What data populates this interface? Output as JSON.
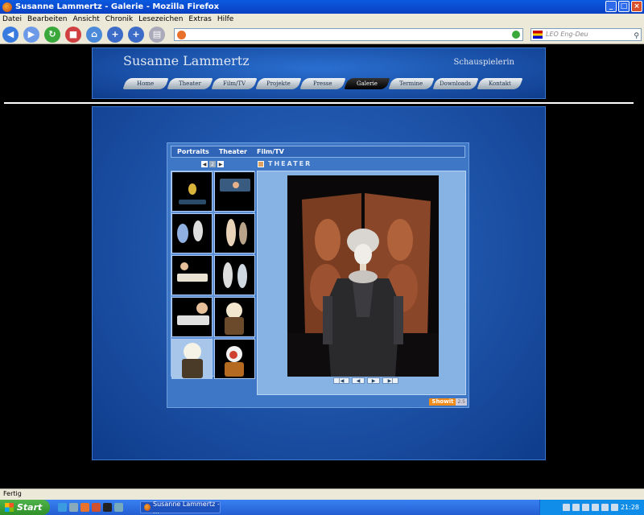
{
  "window": {
    "title": "Susanne Lammertz - Galerie - Mozilla Firefox"
  },
  "menu": [
    "Datei",
    "Bearbeiten",
    "Ansicht",
    "Chronik",
    "Lesezeichen",
    "Extras",
    "Hilfe"
  ],
  "search": {
    "placeholder": "LEO Eng-Deu"
  },
  "site": {
    "name": "Susanne Lammertz",
    "subtitle": "Schauspielerin",
    "nav": [
      "Home",
      "Theater",
      "Film/TV",
      "Projekte",
      "Presse",
      "Galerie",
      "Termine",
      "Downloads",
      "Kontakt"
    ],
    "active_nav": "Galerie"
  },
  "gallery": {
    "tabs": [
      "Portraits",
      "Theater",
      "Film/TV"
    ],
    "pager": [
      "◀",
      "2",
      "▶"
    ],
    "section": "THEATER",
    "controls": [
      "|◀",
      "◀",
      "▶",
      "▶|"
    ],
    "showit": "Showit",
    "showit_tag": "2.5"
  },
  "status": {
    "text": "Fertig"
  },
  "taskbar": {
    "start": "Start",
    "window": "Susanne Lammertz - ...",
    "clock": "21:28"
  }
}
